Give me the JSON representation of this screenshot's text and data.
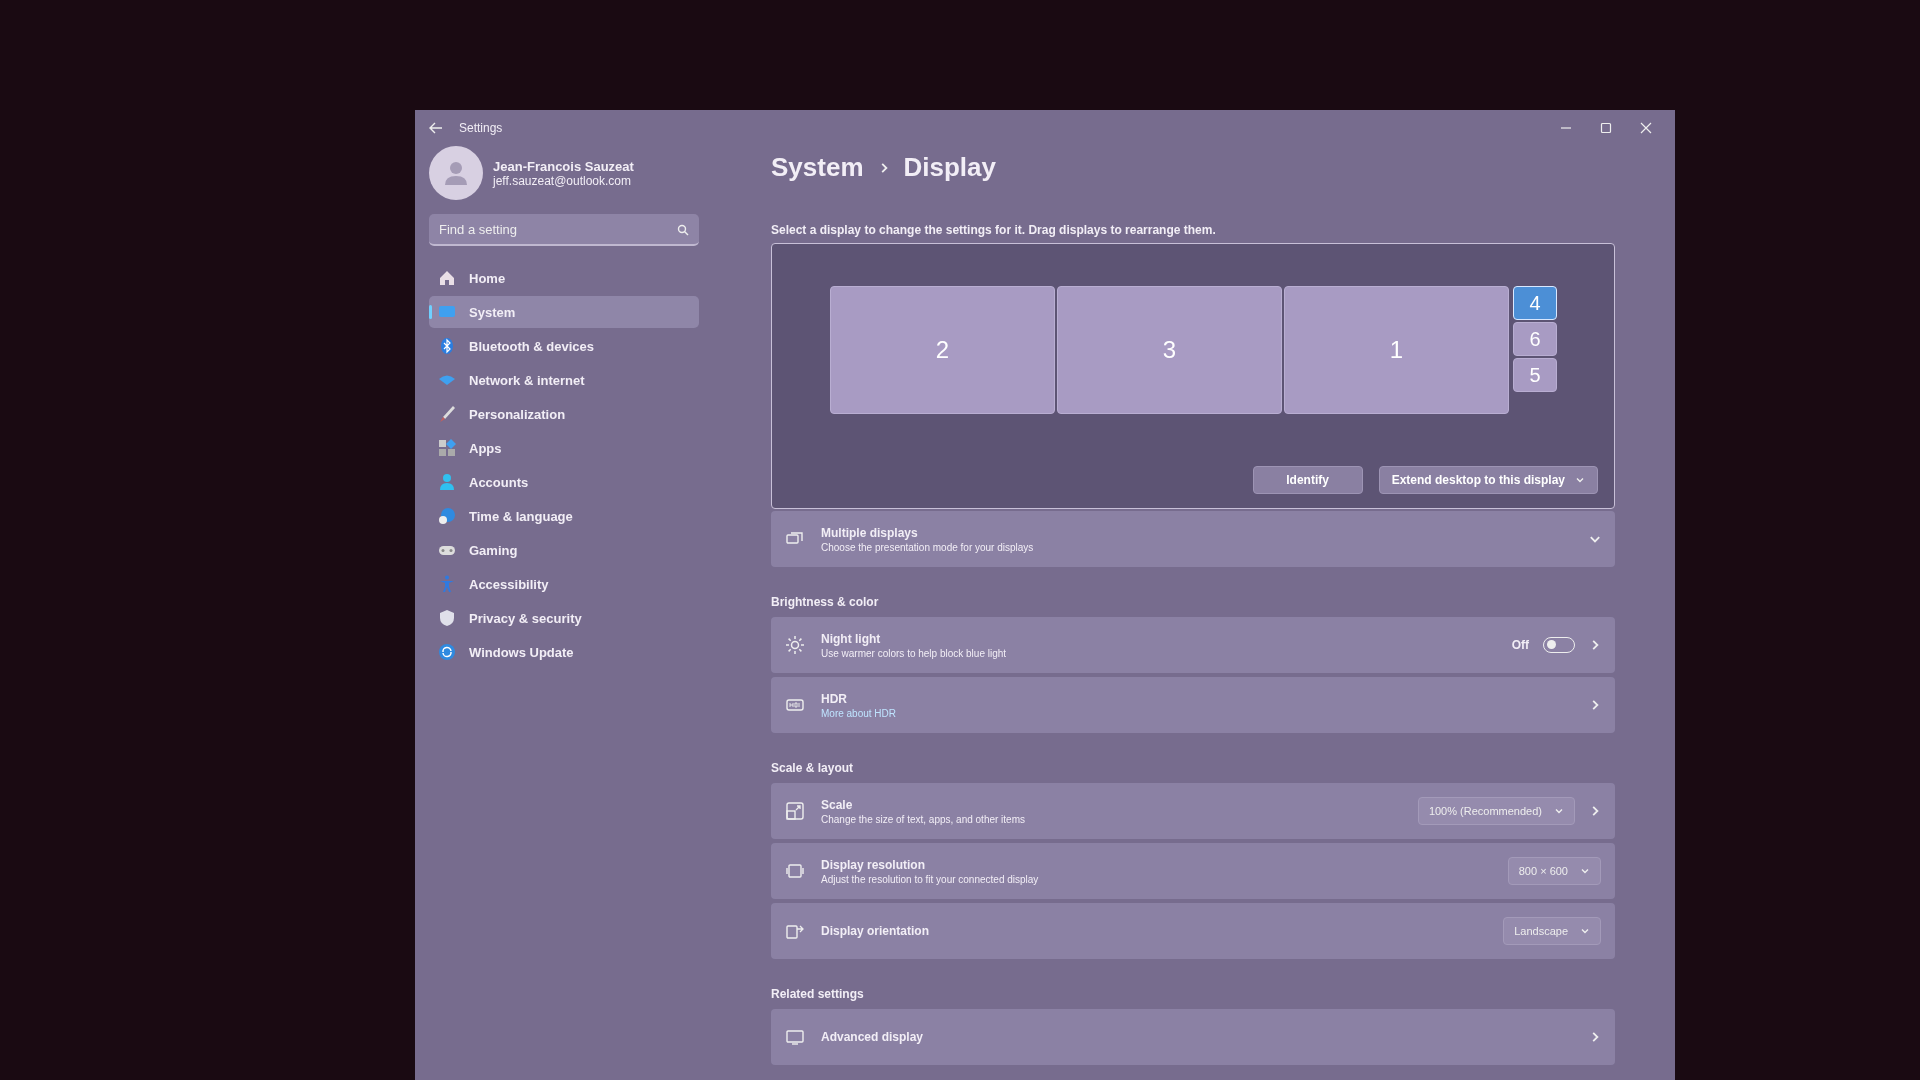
{
  "window": {
    "title": "Settings"
  },
  "user": {
    "name": "Jean-Francois Sauzeat",
    "email": "jeff.sauzeat@outlook.com"
  },
  "search": {
    "placeholder": "Find a setting"
  },
  "sidebar": {
    "items": [
      {
        "label": "Home",
        "selected": false
      },
      {
        "label": "System",
        "selected": true
      },
      {
        "label": "Bluetooth & devices",
        "selected": false
      },
      {
        "label": "Network & internet",
        "selected": false
      },
      {
        "label": "Personalization",
        "selected": false
      },
      {
        "label": "Apps",
        "selected": false
      },
      {
        "label": "Accounts",
        "selected": false
      },
      {
        "label": "Time & language",
        "selected": false
      },
      {
        "label": "Gaming",
        "selected": false
      },
      {
        "label": "Accessibility",
        "selected": false
      },
      {
        "label": "Privacy & security",
        "selected": false
      },
      {
        "label": "Windows Update",
        "selected": false
      }
    ]
  },
  "breadcrumb": [
    "System",
    "Display"
  ],
  "instruction": "Select a display to change the settings for it. Drag displays to rearrange them.",
  "displays": [
    {
      "label": "2",
      "kind": "large",
      "selected": false
    },
    {
      "label": "3",
      "kind": "large",
      "selected": false
    },
    {
      "label": "1",
      "kind": "large",
      "selected": false
    },
    {
      "label": "4",
      "kind": "small",
      "selected": true
    },
    {
      "label": "6",
      "kind": "small",
      "selected": false
    },
    {
      "label": "5",
      "kind": "small",
      "selected": false
    }
  ],
  "identify_button": "Identify",
  "extend_dropdown": {
    "value": "Extend desktop to this display"
  },
  "groups": [
    {
      "rows": [
        {
          "kind": "expander",
          "title": "Multiple displays",
          "subtitle": "Choose the presentation mode for your displays",
          "expanded": false
        }
      ]
    },
    {
      "heading": "Brightness & color",
      "rows": [
        {
          "kind": "toggle",
          "title": "Night light",
          "subtitle": "Use warmer colors to help block blue light",
          "state_label": "Off",
          "on": false,
          "chevron": true
        },
        {
          "kind": "link",
          "title": "HDR",
          "link": "More about HDR",
          "chevron": true
        }
      ]
    },
    {
      "heading": "Scale & layout",
      "rows": [
        {
          "kind": "dropdown",
          "title": "Scale",
          "subtitle": "Change the size of text, apps, and other items",
          "value": "100% (Recommended)",
          "chevron": true
        },
        {
          "kind": "dropdown",
          "title": "Display resolution",
          "subtitle": "Adjust the resolution to fit your connected display",
          "value": "800 × 600",
          "chevron": false
        },
        {
          "kind": "dropdown",
          "title": "Display orientation",
          "value": "Landscape",
          "chevron": false
        }
      ]
    },
    {
      "heading": "Related settings",
      "rows": [
        {
          "kind": "plain",
          "title": "Advanced display",
          "chevron": true
        }
      ]
    }
  ]
}
